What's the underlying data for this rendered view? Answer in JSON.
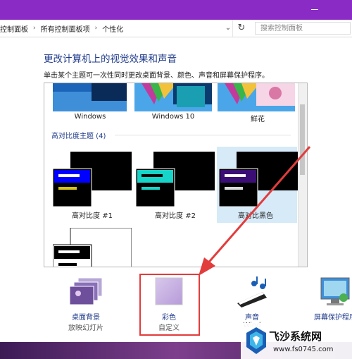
{
  "window": {
    "titlebar_color": "#8a2bc6"
  },
  "address_bar": {
    "breadcrumbs": [
      "控制面板",
      "所有控制面板项",
      "个性化"
    ],
    "search_placeholder": "搜索控制面板"
  },
  "main": {
    "heading": "更改计算机上的视觉效果和声音",
    "description": "单击某个主题可一次性同时更改桌面背景、颜色、声音和屏幕保护程序。"
  },
  "themes": {
    "top_row": [
      "Windows",
      "Windows 10",
      "鲜花"
    ],
    "high_contrast_group_label": "高对比度主题 (4)",
    "high_contrast": [
      "高对比度 #1",
      "高对比度 #2",
      "高对比黑色"
    ]
  },
  "bottom_bar": {
    "items": [
      {
        "label": "桌面背景",
        "sub": "放映幻灯片"
      },
      {
        "label": "彩色",
        "sub": "自定义"
      },
      {
        "label": "声音",
        "sub": "Wind"
      },
      {
        "label": "屏幕保护程序",
        "sub": ""
      }
    ]
  },
  "watermark": {
    "title": "飞沙系统网",
    "url": "www.fs0745.com"
  },
  "colors": {
    "accent": "#1e3a8a",
    "highlight_box": "#e23c3c",
    "selected_theme_bg": "#d6eaf8"
  }
}
